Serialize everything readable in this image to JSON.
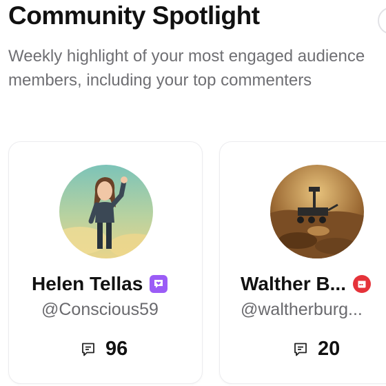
{
  "header": {
    "title": "Community Spotlight",
    "subtitle": "Weekly highlight of your most engaged audience members, including your top commenters"
  },
  "members": [
    {
      "name": "Helen Tellas",
      "handle": "@Conscious59",
      "badge_icon": "heart-message-icon",
      "badge_color": "#9b5cf6",
      "comment_count": "96"
    },
    {
      "name": "Walther B...",
      "handle": "@waltherburg...",
      "badge_icon": "calendar-badge-icon",
      "badge_color": "#e5333a",
      "comment_count": "20"
    }
  ],
  "colors": {
    "title": "#111111",
    "subtitle": "#6f6f73",
    "card_border": "#ececef"
  }
}
